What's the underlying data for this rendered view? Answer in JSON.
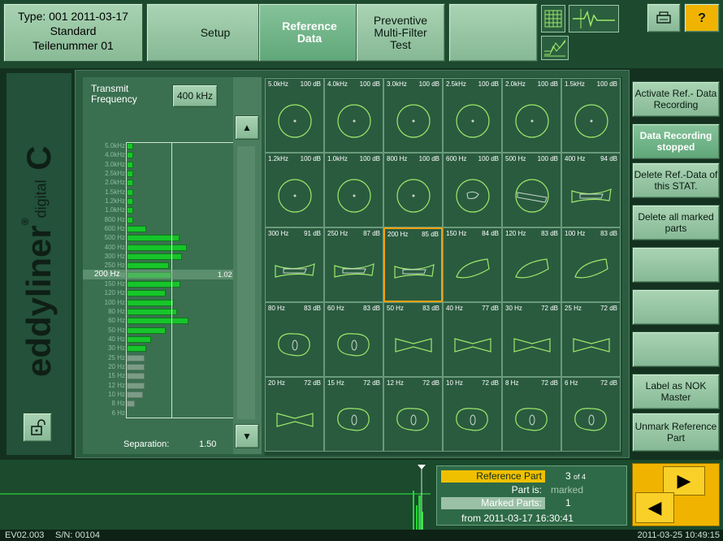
{
  "header": {
    "type_line": "Type: 001   2011-03-17",
    "standard_line": "Standard",
    "part_line": "Teilenummer 01",
    "setup_label": "Setup",
    "refdata_label_1": "Reference",
    "refdata_label_2": "Data",
    "preventive_label_1": "Preventive",
    "preventive_label_2": "Multi-Filter",
    "preventive_label_3": "Test",
    "help_label": "?"
  },
  "sidebar": {
    "logo_text": "eddyliner",
    "logo_reg": "®",
    "logo_c": "C",
    "logo_digital": "digital"
  },
  "transmit": {
    "label": "Transmit Frequency",
    "value": "400 kHz"
  },
  "histogram": {
    "rows": [
      {
        "label": "5.0kHz",
        "value": 8,
        "color": "green"
      },
      {
        "label": "4.0kHz",
        "value": 8,
        "color": "green"
      },
      {
        "label": "3.0kHz",
        "value": 8,
        "color": "green"
      },
      {
        "label": "2.5kHz",
        "value": 8,
        "color": "green"
      },
      {
        "label": "2.0kHz",
        "value": 8,
        "color": "green"
      },
      {
        "label": "1.5kHz",
        "value": 8,
        "color": "green"
      },
      {
        "label": "1.2kHz",
        "value": 8,
        "color": "green"
      },
      {
        "label": "1.0kHz",
        "value": 8,
        "color": "green"
      },
      {
        "label": "800 Hz",
        "value": 8,
        "color": "green"
      },
      {
        "label": "600 Hz",
        "value": 24,
        "color": "green"
      },
      {
        "label": "500 Hz",
        "value": 65,
        "color": "green"
      },
      {
        "label": "400 Hz",
        "value": 74,
        "color": "green"
      },
      {
        "label": "300 Hz",
        "value": 68,
        "color": "green"
      },
      {
        "label": "250 Hz",
        "value": 52,
        "color": "green"
      },
      {
        "label": "200 Hz",
        "value": 55,
        "color": "green"
      },
      {
        "label": "150 Hz",
        "value": 66,
        "color": "green"
      },
      {
        "label": "120 Hz",
        "value": 48,
        "color": "green"
      },
      {
        "label": "100 Hz",
        "value": 58,
        "color": "green"
      },
      {
        "label": "80 Hz",
        "value": 62,
        "color": "green"
      },
      {
        "label": "60 Hz",
        "value": 76,
        "color": "green"
      },
      {
        "label": "50 Hz",
        "value": 48,
        "color": "green"
      },
      {
        "label": "40 Hz",
        "value": 30,
        "color": "green"
      },
      {
        "label": "30 Hz",
        "value": 24,
        "color": "green"
      },
      {
        "label": "25 Hz",
        "value": 22,
        "color": "gray"
      },
      {
        "label": "20 Hz",
        "value": 22,
        "color": "gray"
      },
      {
        "label": "15 Hz",
        "value": 22,
        "color": "gray"
      },
      {
        "label": "12 Hz",
        "value": 22,
        "color": "gray"
      },
      {
        "label": "10 Hz",
        "value": 20,
        "color": "gray"
      },
      {
        "label": "8 Hz",
        "value": 10,
        "color": "gray"
      },
      {
        "label": "6 Hz",
        "value": 0,
        "color": "gray"
      }
    ],
    "selected_label": "200 Hz",
    "selected_value": "1.02",
    "separation_label": "Separation:",
    "separation_value": "1.50"
  },
  "grid": {
    "cells": [
      {
        "freq": "5.0kHz",
        "db": "100 dB",
        "shape": "circle-dot"
      },
      {
        "freq": "4.0kHz",
        "db": "100 dB",
        "shape": "circle-dot"
      },
      {
        "freq": "3.0kHz",
        "db": "100 dB",
        "shape": "circle-dot"
      },
      {
        "freq": "2.5kHz",
        "db": "100 dB",
        "shape": "circle-dot"
      },
      {
        "freq": "2.0kHz",
        "db": "100 dB",
        "shape": "circle-dot"
      },
      {
        "freq": "1.5kHz",
        "db": "100 dB",
        "shape": "circle-dot"
      },
      {
        "freq": "1.2kHz",
        "db": "100 dB",
        "shape": "circle-dot"
      },
      {
        "freq": "1.0kHz",
        "db": "100 dB",
        "shape": "circle-dot"
      },
      {
        "freq": "800 Hz",
        "db": "100 dB",
        "shape": "circle-dot"
      },
      {
        "freq": "600 Hz",
        "db": "100 dB",
        "shape": "circle-blob"
      },
      {
        "freq": "500 Hz",
        "db": "100 dB",
        "shape": "circle-bar"
      },
      {
        "freq": "400 Hz",
        "db": "94 dB",
        "shape": "bar"
      },
      {
        "freq": "300 Hz",
        "db": "91 dB",
        "shape": "bar"
      },
      {
        "freq": "250 Hz",
        "db": "87 dB",
        "shape": "bar"
      },
      {
        "freq": "200 Hz",
        "db": "85 dB",
        "shape": "bar"
      },
      {
        "freq": "150 Hz",
        "db": "84 dB",
        "shape": "tilt"
      },
      {
        "freq": "120 Hz",
        "db": "83 dB",
        "shape": "tilt"
      },
      {
        "freq": "100 Hz",
        "db": "83 dB",
        "shape": "tilt"
      },
      {
        "freq": "80 Hz",
        "db": "83 dB",
        "shape": "blob"
      },
      {
        "freq": "60 Hz",
        "db": "83 dB",
        "shape": "blob"
      },
      {
        "freq": "50 Hz",
        "db": "83 dB",
        "shape": "bow"
      },
      {
        "freq": "40 Hz",
        "db": "77 dB",
        "shape": "bow"
      },
      {
        "freq": "30 Hz",
        "db": "72 dB",
        "shape": "bow"
      },
      {
        "freq": "25 Hz",
        "db": "72 dB",
        "shape": "bow"
      },
      {
        "freq": "20 Hz",
        "db": "72 dB",
        "shape": "bow"
      },
      {
        "freq": "15 Hz",
        "db": "72 dB",
        "shape": "blob"
      },
      {
        "freq": "12 Hz",
        "db": "72 dB",
        "shape": "blob"
      },
      {
        "freq": "10 Hz",
        "db": "72 dB",
        "shape": "blob"
      },
      {
        "freq": "8 Hz",
        "db": "72 dB",
        "shape": "blob"
      },
      {
        "freq": "6 Hz",
        "db": "72 dB",
        "shape": "blob"
      }
    ],
    "selected_index": 14
  },
  "right": {
    "b1": "Activate Ref.- Data Recording",
    "b2": "Data Recording stopped",
    "b3": "Delete Ref.-Data of this STAT.",
    "b4": "Delete all marked parts",
    "b5": "Label as NOK Master",
    "b6": "Unmark Reference Part"
  },
  "info": {
    "ref_label": "Reference Part",
    "count_num": "3",
    "count_of": "of 4",
    "partis_label": "Part is:",
    "partis_value": "marked",
    "marked_label": "Marked Parts:",
    "marked_value": "1",
    "from": "from  2011-03-17  16:30:41"
  },
  "status": {
    "version": "EV02.003",
    "serial": "S/N: 00104",
    "datetime": "2011-03-25  10:49:15"
  },
  "colors": {
    "accent": "#f0b400",
    "bar_green": "#17c52a",
    "plot_line": "#9ee86a"
  }
}
